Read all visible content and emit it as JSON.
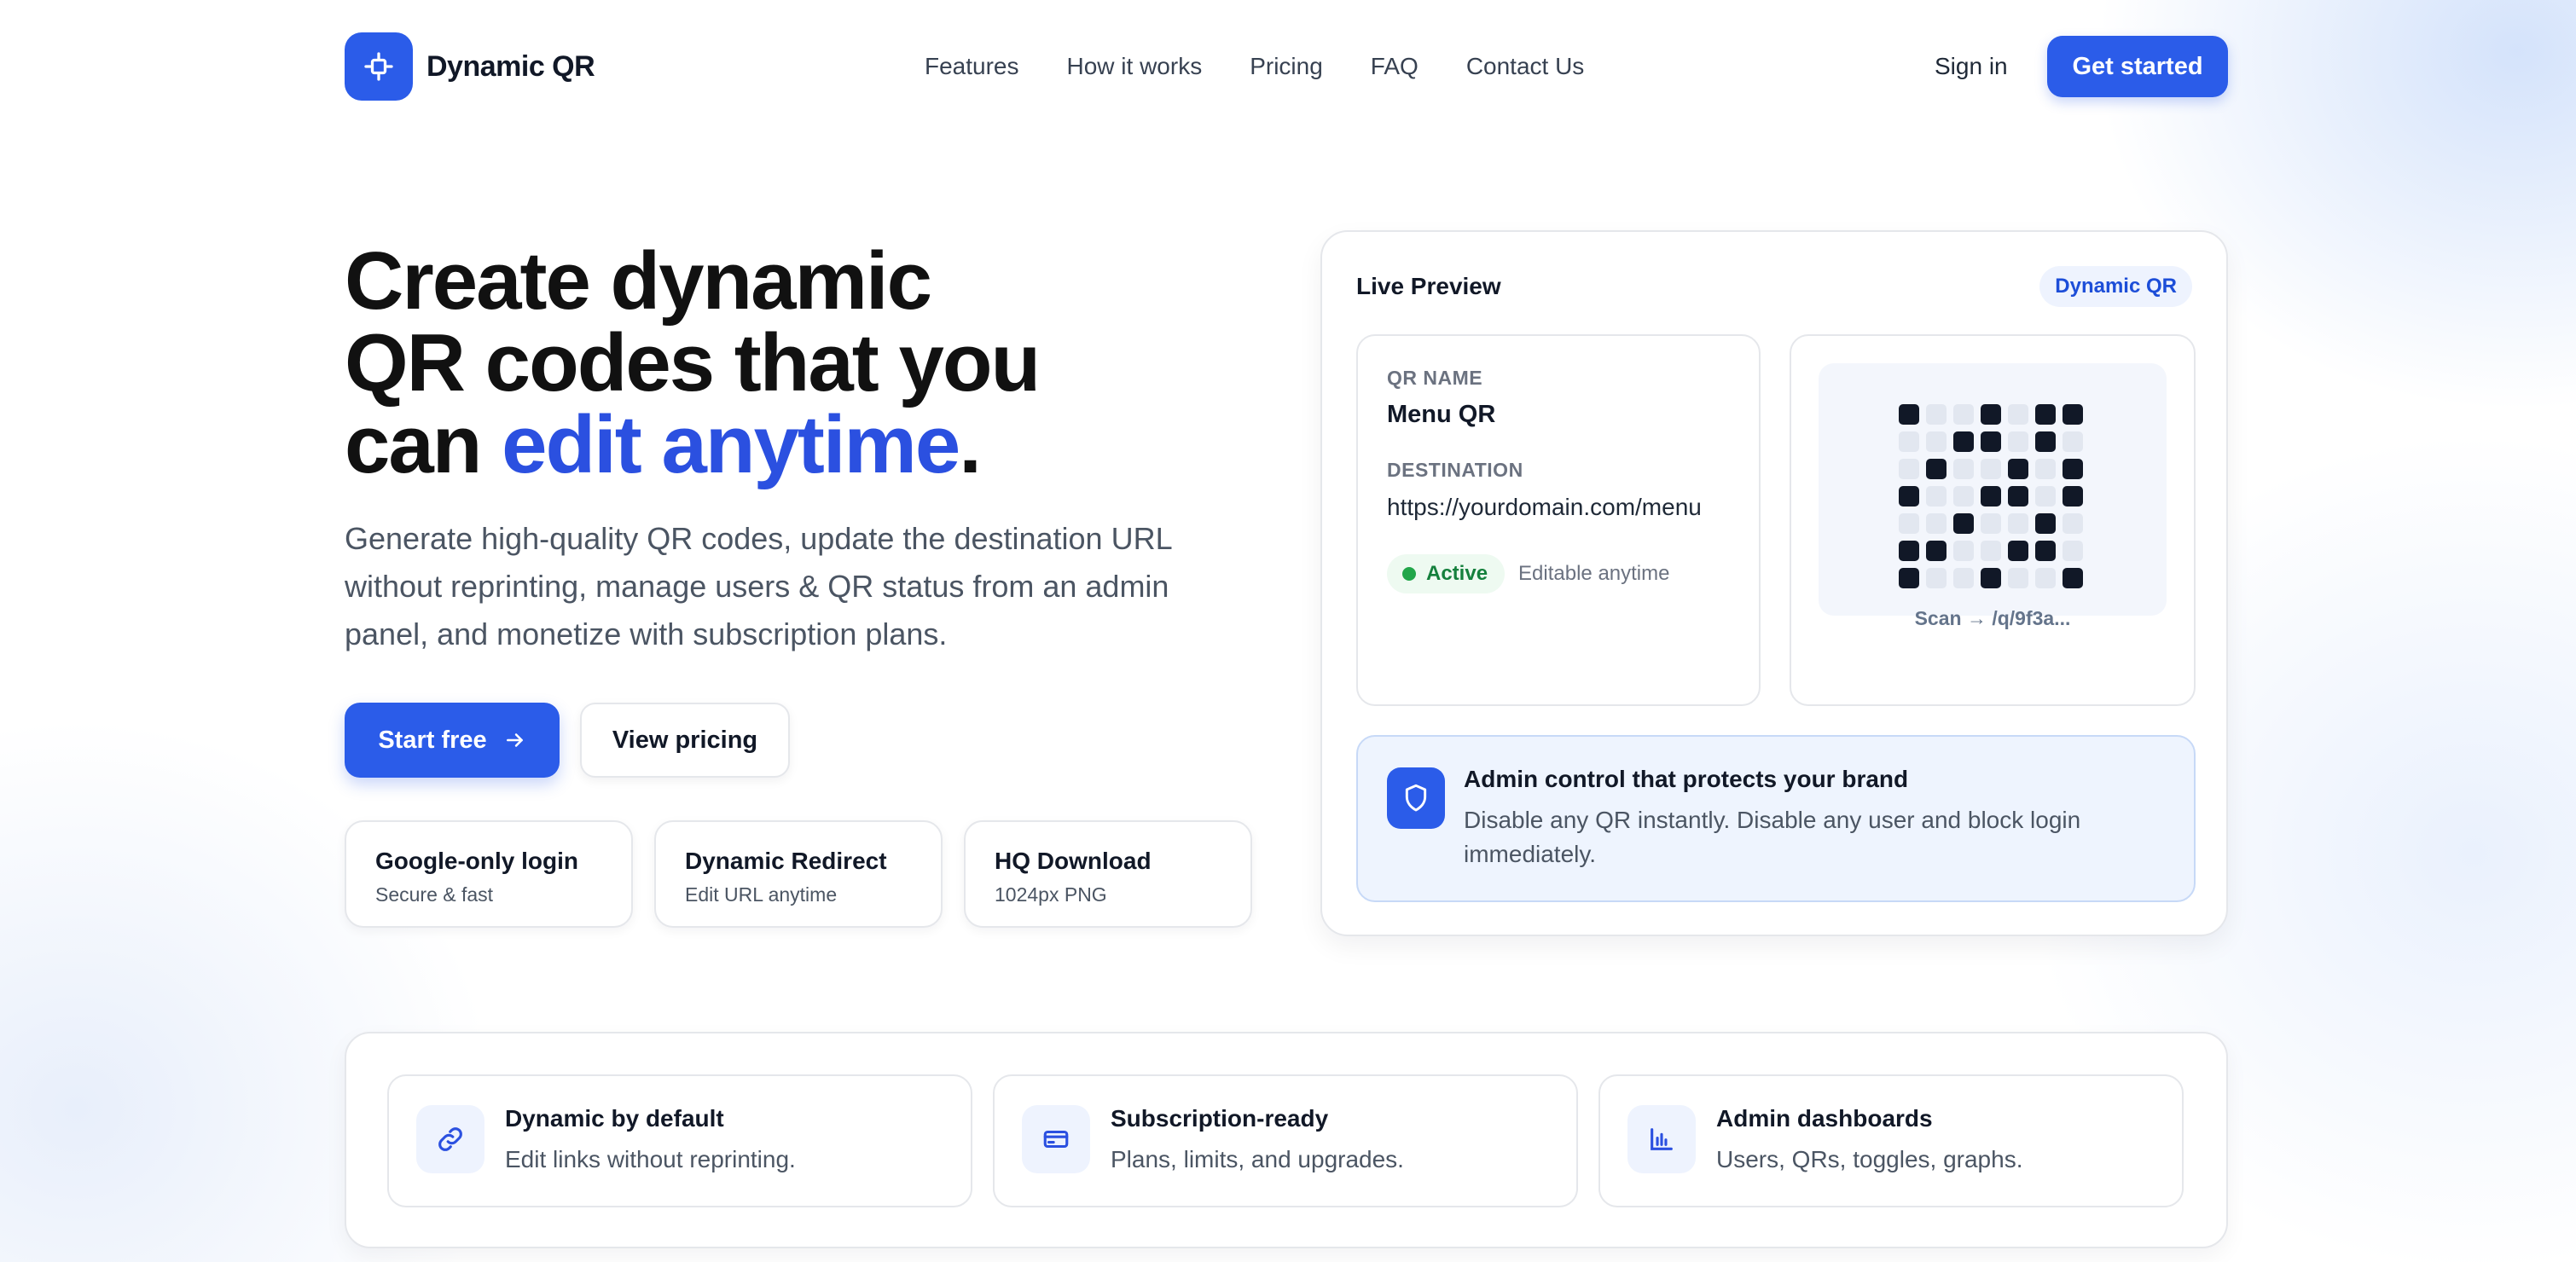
{
  "brand": {
    "name": "Dynamic QR",
    "accent_color": "#2b5ce9"
  },
  "nav": {
    "links": [
      "Features",
      "How it works",
      "Pricing",
      "FAQ",
      "Contact Us"
    ],
    "sign_in": "Sign in",
    "get_started": "Get started"
  },
  "hero": {
    "title_line1": "Create dynamic",
    "title_line2": "QR codes that you",
    "title_line3_prefix": "can ",
    "title_accent": "edit anytime",
    "title_suffix": ".",
    "subtitle": "Generate high-quality QR codes, update the destination URL without reprinting, manage users & QR status from an admin panel, and monetize with subscription plans.",
    "primary_cta": "Start free",
    "secondary_cta": "View pricing",
    "mini_cards": [
      {
        "title": "Google-only login",
        "subtitle": "Secure & fast"
      },
      {
        "title": "Dynamic Redirect",
        "subtitle": "Edit URL anytime"
      },
      {
        "title": "HQ Download",
        "subtitle": "1024px PNG"
      }
    ]
  },
  "preview": {
    "title": "Live Preview",
    "badge": "Dynamic QR",
    "qr_name_label": "QR NAME",
    "qr_name": "Menu QR",
    "destination_label": "DESTINATION",
    "destination": "https://yourdomain.com/menu",
    "status": "Active",
    "status_note": "Editable anytime",
    "status_color": "#22a64a",
    "scan_caption": "Scan → /q/9f3a...",
    "qr_pattern": [
      "1001011",
      "0011010",
      "0100101",
      "1001101",
      "0010010",
      "1100110",
      "1001001"
    ],
    "admin_title": "Admin control that protects your brand",
    "admin_text": "Disable any QR instantly. Disable any user and block login immediately."
  },
  "features": [
    {
      "icon": "link-icon",
      "title": "Dynamic by default",
      "subtitle": "Edit links without reprinting."
    },
    {
      "icon": "credit-card-icon",
      "title": "Subscription-ready",
      "subtitle": "Plans, limits, and upgrades."
    },
    {
      "icon": "bar-chart-icon",
      "title": "Admin dashboards",
      "subtitle": "Users, QRs, toggles, graphs."
    }
  ]
}
